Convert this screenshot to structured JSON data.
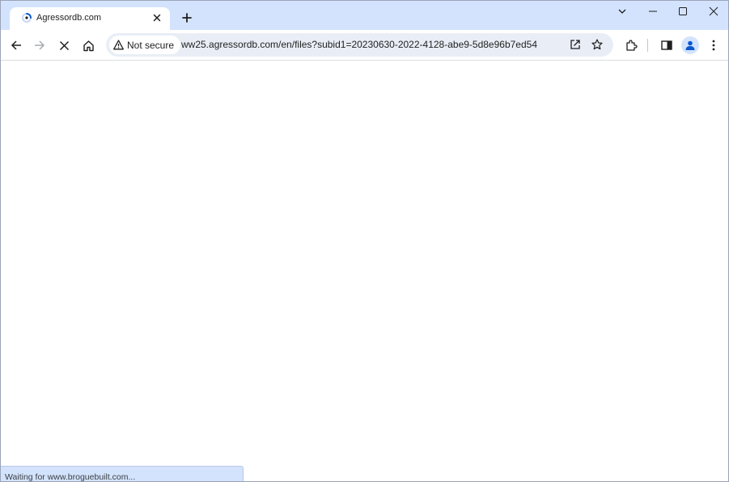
{
  "tab": {
    "title": "Agressordb.com",
    "favicon": "loading-spinner-icon",
    "close_icon": "close-icon"
  },
  "new_tab_icon": "plus-icon",
  "window_controls": [
    "chevron-down-icon",
    "minimize-icon",
    "maximize-icon",
    "close-icon"
  ],
  "toolbar": {
    "back_icon": "back-arrow-icon",
    "forward_icon": "forward-arrow-icon",
    "stop_icon": "stop-icon",
    "home_icon": "home-icon"
  },
  "omnibox": {
    "security_label": "Not secure",
    "security_icon": "warning-triangle-icon",
    "url": "ww25.agressordb.com/en/files?subid1=20230630-2022-4128-abe9-5d8e96b7ed54",
    "share_icon": "share-icon",
    "bookmark_icon": "star-icon"
  },
  "right_icons": [
    "extensions-icon",
    "side-panel-icon",
    "profile-icon",
    "menu-icon"
  ],
  "status": {
    "text": "Waiting for www.broguebuilt.com..."
  },
  "colors": {
    "tabstrip_bg": "#d3e3fd",
    "omnibox_bg": "#e9eef6",
    "status_bg": "#d3e3fd",
    "profile_blue": "#0b57d0"
  }
}
